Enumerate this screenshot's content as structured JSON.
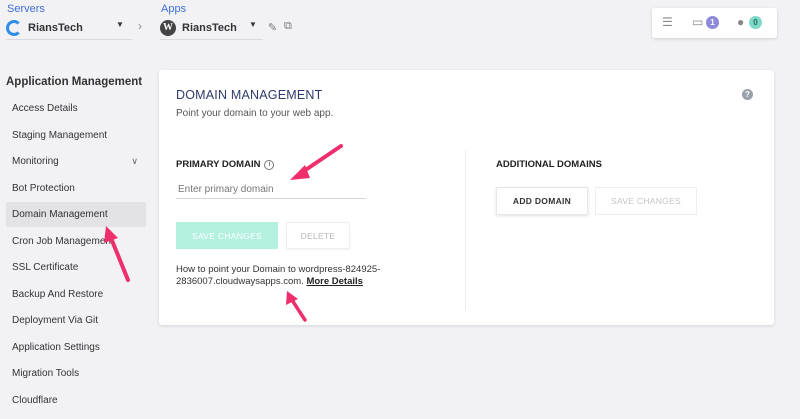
{
  "topbar": {
    "servers_label": "Servers",
    "server_name": "RiansTech",
    "apps_label": "Apps",
    "app_name": "RiansTech",
    "notification_count": "1",
    "user_count": "0"
  },
  "sidebar": {
    "title": "Application Management",
    "items": [
      {
        "label": "Access Details"
      },
      {
        "label": "Staging Management"
      },
      {
        "label": "Monitoring"
      },
      {
        "label": "Bot Protection"
      },
      {
        "label": "Domain Management"
      },
      {
        "label": "Cron Job Management"
      },
      {
        "label": "SSL Certificate"
      },
      {
        "label": "Backup And Restore"
      },
      {
        "label": "Deployment Via Git"
      },
      {
        "label": "Application Settings"
      },
      {
        "label": "Migration Tools"
      },
      {
        "label": "Cloudflare"
      }
    ]
  },
  "card": {
    "title": "DOMAIN MANAGEMENT",
    "subtitle": "Point your domain to your web app.",
    "help": "?",
    "primary_label": "PRIMARY DOMAIN",
    "primary_placeholder": "Enter primary domain",
    "save_label": "SAVE CHANGES",
    "delete_label": "DELETE",
    "how_text": "How to point your Domain to wordpress-824925-2836007.cloudwaysapps.com.",
    "more_link": "More Details",
    "additional_label": "ADDITIONAL DOMAINS",
    "add_label": "ADD DOMAIN",
    "save2_label": "SAVE CHANGES"
  },
  "colors": {
    "accent": "#3d6fdb",
    "title": "#2e3b6e",
    "save_button": "#b3f0df",
    "arrow": "#ee2f6b"
  }
}
